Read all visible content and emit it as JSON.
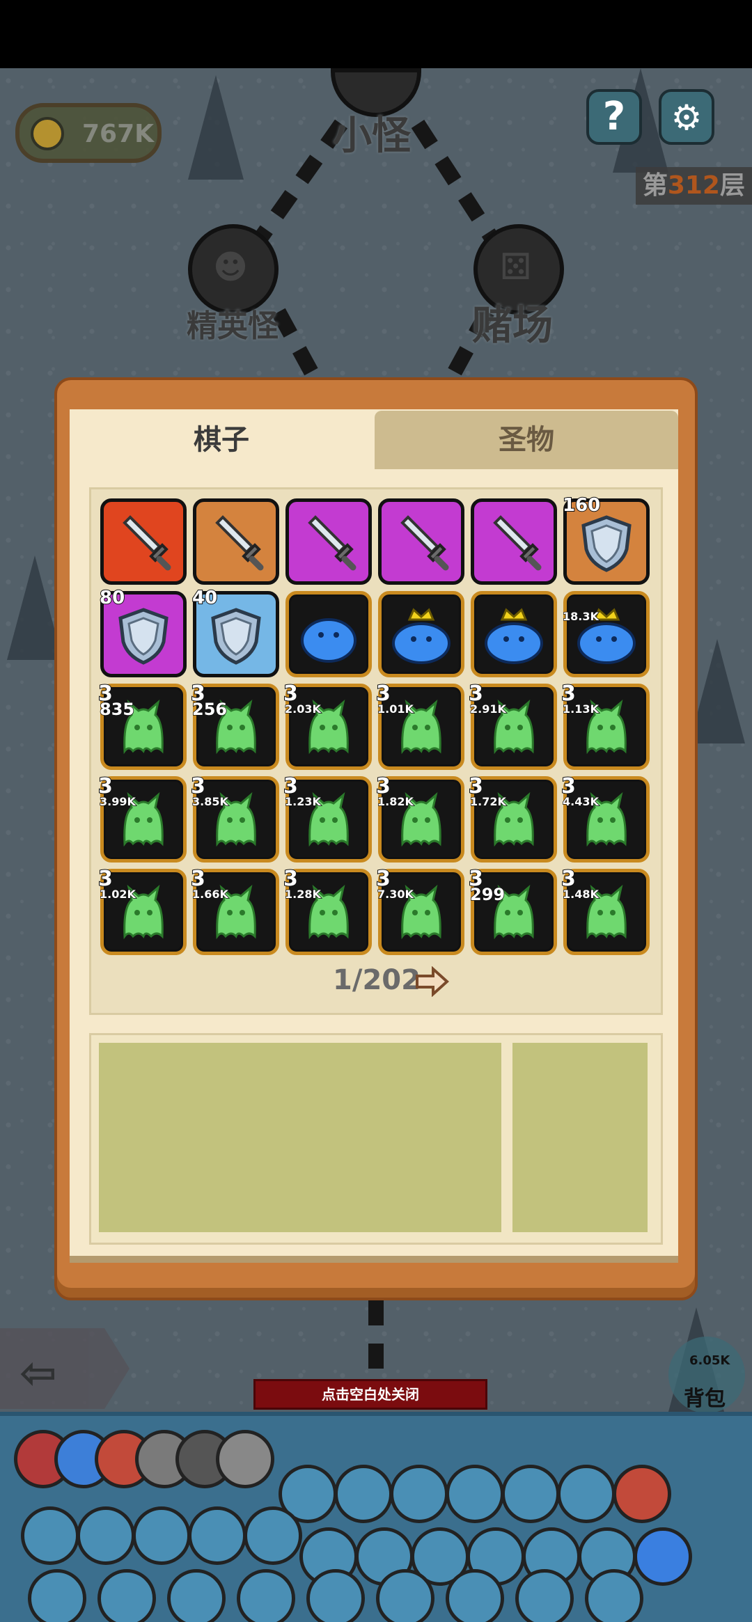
{
  "hud": {
    "coins": "767K",
    "floor_prefix": "第",
    "floor_number": "312",
    "floor_suffix": "层",
    "help_label": "?",
    "settings_icon": "gear-icon"
  },
  "map": {
    "nodes": [
      {
        "label": "小怪",
        "icon": "skull-icon"
      },
      {
        "label": "精英怪",
        "icon": "demon-icon"
      },
      {
        "label": "赌场",
        "icon": "dice-icon"
      }
    ]
  },
  "modal": {
    "tabs": [
      {
        "label": "棋子",
        "active": true
      },
      {
        "label": "圣物",
        "active": false
      }
    ],
    "pieces": [
      {
        "kind": "sword",
        "color": "red"
      },
      {
        "kind": "sword",
        "color": "orange"
      },
      {
        "kind": "sword",
        "color": "purple"
      },
      {
        "kind": "sword",
        "color": "purple"
      },
      {
        "kind": "sword",
        "color": "purple"
      },
      {
        "kind": "shield",
        "color": "orange",
        "badge": "160"
      },
      {
        "kind": "shield",
        "color": "purple",
        "badge": "80"
      },
      {
        "kind": "shield",
        "color": "blue",
        "badge": "40"
      },
      {
        "kind": "slime",
        "color": "dark"
      },
      {
        "kind": "king-slime",
        "color": "dark"
      },
      {
        "kind": "king-slime",
        "color": "dark"
      },
      {
        "kind": "king-slime",
        "color": "dark",
        "value": "18.3K"
      },
      {
        "kind": "ghost",
        "color": "dark",
        "level": "3",
        "value": "835"
      },
      {
        "kind": "ghost",
        "color": "dark",
        "level": "3",
        "value": "256"
      },
      {
        "kind": "ghost",
        "color": "dark",
        "level": "3",
        "value": "2.03K"
      },
      {
        "kind": "ghost",
        "color": "dark",
        "level": "3",
        "value": "1.01K"
      },
      {
        "kind": "ghost",
        "color": "dark",
        "level": "3",
        "value": "2.91K"
      },
      {
        "kind": "ghost",
        "color": "dark",
        "level": "3",
        "value": "1.13K"
      },
      {
        "kind": "ghost",
        "color": "dark",
        "level": "3",
        "value": "3.99K"
      },
      {
        "kind": "ghost",
        "color": "dark",
        "level": "3",
        "value": "3.85K"
      },
      {
        "kind": "ghost",
        "color": "dark",
        "level": "3",
        "value": "1.23K"
      },
      {
        "kind": "ghost",
        "color": "dark",
        "level": "3",
        "value": "1.82K"
      },
      {
        "kind": "ghost",
        "color": "dark",
        "level": "3",
        "value": "1.72K"
      },
      {
        "kind": "ghost",
        "color": "dark",
        "level": "3",
        "value": "4.43K"
      },
      {
        "kind": "ghost",
        "color": "dark",
        "level": "3",
        "value": "1.02K"
      },
      {
        "kind": "ghost",
        "color": "dark",
        "level": "3",
        "value": "1.66K"
      },
      {
        "kind": "ghost",
        "color": "dark",
        "level": "3",
        "value": "1.28K"
      },
      {
        "kind": "ghost",
        "color": "dark",
        "level": "3",
        "value": "7.30K"
      },
      {
        "kind": "ghost",
        "color": "dark",
        "level": "3",
        "value": "299"
      },
      {
        "kind": "ghost",
        "color": "dark",
        "level": "3",
        "value": "1.48K"
      }
    ],
    "pager": "1/202"
  },
  "bottom": {
    "close_hint": "点击空白处关闭",
    "bag_count": "6.05K",
    "bag_label": "背包"
  },
  "colors": {
    "modal_frame": "#c87a3b",
    "modal_paper": "#f6e9cb",
    "info_fill": "#c2c27d",
    "hint_bg": "#7b0c0f"
  }
}
